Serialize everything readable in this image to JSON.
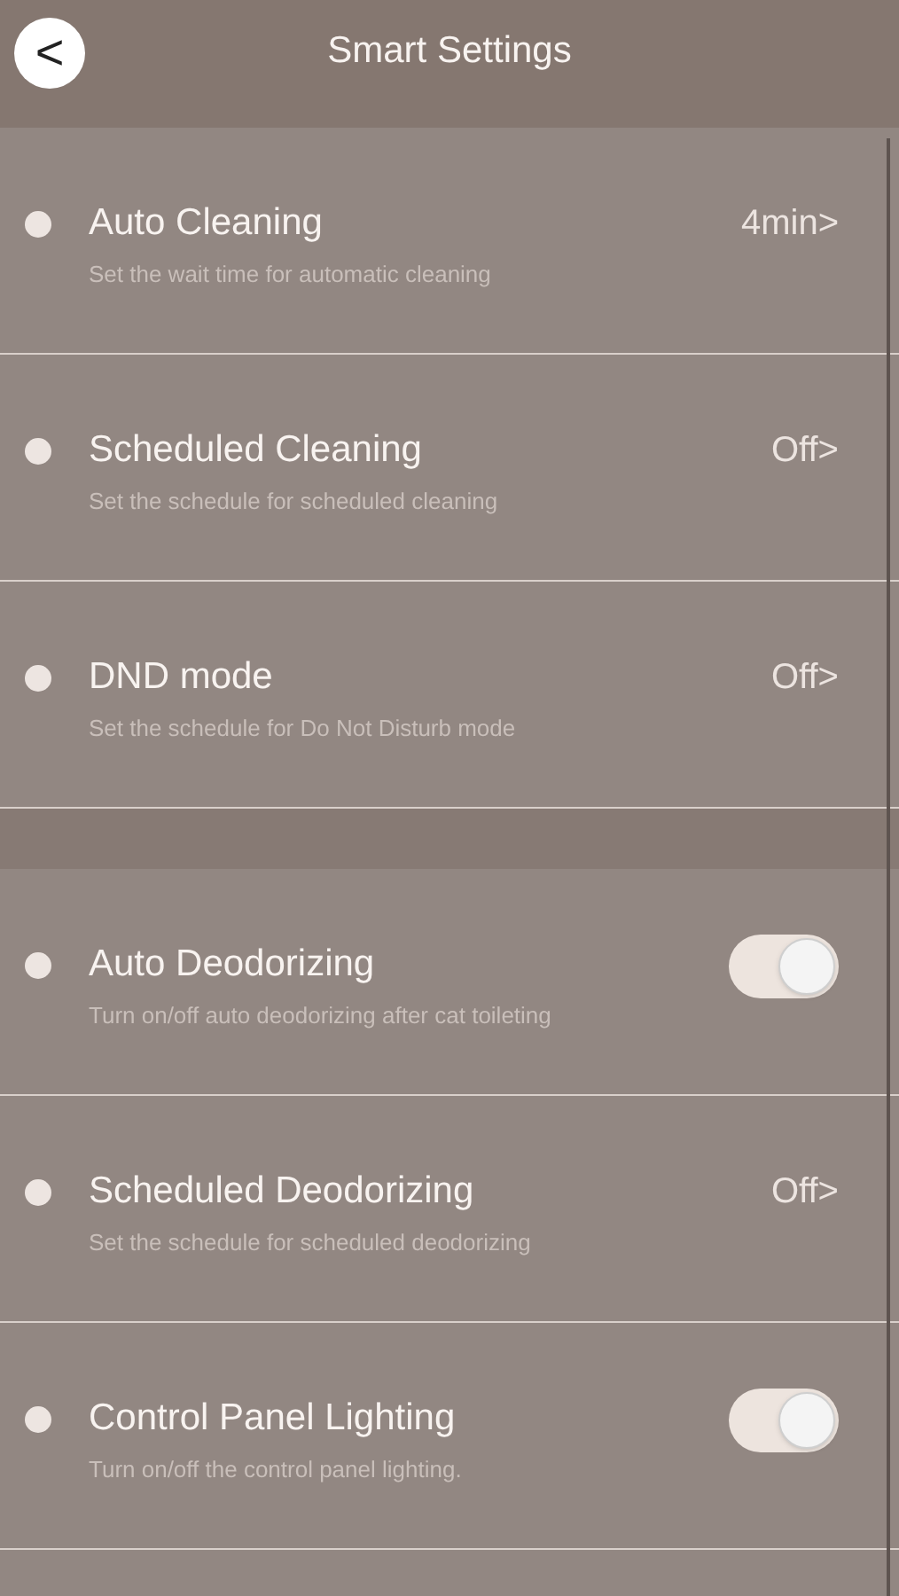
{
  "header": {
    "back": "<",
    "title": "Smart Settings"
  },
  "groups": [
    {
      "items": [
        {
          "kind": "value",
          "title": "Auto Cleaning",
          "subtitle": "Set the wait time for automatic cleaning",
          "value": "4min>"
        },
        {
          "kind": "value",
          "title": "Scheduled Cleaning",
          "subtitle": "Set the schedule for scheduled cleaning",
          "value": "Off>"
        },
        {
          "kind": "value",
          "title": "DND mode",
          "subtitle": "Set the schedule for Do Not Disturb mode",
          "value": "Off>"
        }
      ]
    },
    {
      "items": [
        {
          "kind": "toggle",
          "title": "Auto Deodorizing",
          "subtitle": "Turn on/off auto deodorizing after cat toileting",
          "on": true
        },
        {
          "kind": "value",
          "title": "Scheduled Deodorizing",
          "subtitle": "Set the schedule for scheduled deodorizing",
          "value": "Off>"
        },
        {
          "kind": "toggle",
          "title": "Control Panel Lighting",
          "subtitle": "Turn on/off the control panel lighting.",
          "on": true
        }
      ]
    }
  ]
}
